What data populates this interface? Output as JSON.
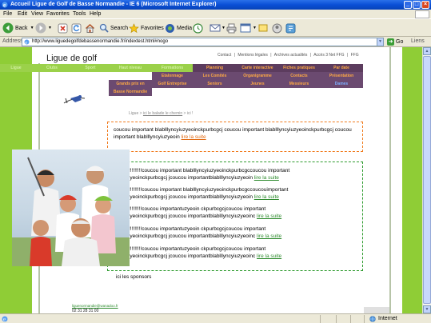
{
  "window": {
    "title": "Accueil Ligue de Golf de Basse Normandie - IE 6 (Microsoft Internet Explorer)",
    "controls": {
      "minimize": "_",
      "maximize": "□",
      "close": "×"
    }
  },
  "menubar": {
    "items": [
      "File",
      "Edit",
      "View",
      "Favorites",
      "Tools",
      "Help"
    ]
  },
  "toolbar": {
    "back_label": "Back",
    "search_label": "Search",
    "favorites_label": "Favorites",
    "media_label": "Media",
    "icons": [
      "back-icon",
      "forward-icon",
      "stop-icon",
      "refresh-icon",
      "home-icon",
      "search-icon",
      "favorites-icon",
      "media-icon",
      "history-icon",
      "mail-icon",
      "print-icon",
      "edit-icon",
      "discuss-icon",
      "messenger-icon",
      "research-icon"
    ]
  },
  "addressbar": {
    "label": "Address",
    "url": "http://www.liguedegolfdebassenormandie.fr/indextest.html#nogo",
    "go_label": "Go",
    "links_label": "Liens"
  },
  "page": {
    "site_title": "Ligue de golf",
    "toplinks": [
      "Contact",
      "|",
      "Mentions légales",
      "|",
      "Archives actualités",
      "|",
      "Accès 3 Net FFG",
      "|",
      "FFG"
    ],
    "nav_row1": [
      {
        "label": "Ligue",
        "style": "green"
      },
      {
        "label": "Clubs",
        "style": "green"
      },
      {
        "label": "Sport",
        "style": "green"
      },
      {
        "label": "Haut niveau",
        "style": "green"
      },
      {
        "label": "Formations",
        "style": "green"
      },
      {
        "label": "Planning",
        "style": "dark"
      },
      {
        "label": "Carte interactive",
        "style": "dark"
      },
      {
        "label": "Fiches pratiques",
        "style": "dark"
      },
      {
        "label": "Par date",
        "style": "dark"
      }
    ],
    "nav_row2": [
      {
        "label": "Etalonnage",
        "style": "dark"
      },
      {
        "label": "Les Comités",
        "style": "dark"
      },
      {
        "label": "Organigramme",
        "style": "dark"
      },
      {
        "label": "Contacts",
        "style": "dark"
      },
      {
        "label": "Présentation",
        "style": "dark"
      }
    ],
    "nav_row3": [
      {
        "label": "Grands prix en",
        "style": "dark"
      },
      {
        "label": "Golf Entreprise",
        "style": "dark"
      },
      {
        "label": "Seniors",
        "style": "dark"
      },
      {
        "label": "Jeunes",
        "style": "dark"
      },
      {
        "label": "Messieurs",
        "style": "dark"
      },
      {
        "label": "Dames",
        "style": "blue"
      }
    ],
    "nav_row4": [
      {
        "label": "Basse Normandie",
        "style": "dark"
      }
    ],
    "breadcrumb": {
      "prefix": "Ligue > ",
      "link": "ici le balade le chemin",
      "suffix": " > ici !"
    },
    "intro": {
      "text": "coucou important blablllyncyiuzyeoinckpurbcgcj coucou important blablllyncyiuzyeoinckpurbcgcj coucou important blablllyncyiuzyeoin",
      "link": "lire la suite"
    },
    "news": [
      {
        "line1": "lités !!!!!!!!!!!coucou important blablllyncyiuzyeoinckpurbcgccoucou important",
        "line2": "ncyiuzyeoinckpurbcgcj jcoucou importantblablllyncyiuzyeoin",
        "link": "lire la suite"
      },
      {
        "line1": "lités !!!!!!!!!!!coucou important blablllyncyiuzyeoinckpurbcgccoucouimportant",
        "line2": "ncyiuzyeoinckpurbcgcj jcoucou importantblablllyncyiuzyeoin",
        "link": "lire la suite"
      },
      {
        "line1": "lités !!!!!!!!!!!coucou importantuzyeoin ckpurbcgcjcoucou important",
        "line2": "ncyiuzyeoinckpurbcgcj jcoucou importantblablllyncyiuzyeoinc",
        "link": "lire la suite"
      },
      {
        "line1": "lités !!!!!!!!!!!coucou importantuzyeoin ckpurbcgcjcoucou important",
        "line2": "ncyiuzyeoinckpurbcgcj jcoucou importantblablllyncyiuzyeoinc",
        "link": "lire la suite"
      },
      {
        "line1": "lités !!!!!!!!!!!coucou importantuzyeoin ckpurbcgcjcoucou important",
        "line2": "ncyiuzyeoinckpurbcgcj jcoucou importantblablllyncyiuzyeoinc",
        "link": "lire la suite"
      }
    ],
    "sponsors": "ici les sponsors",
    "footer_email": "liguenormandie@wanadoo.fr",
    "footer_phone": "02 31 28 31 00"
  },
  "statusbar": {
    "zone": "Internet"
  },
  "colors": {
    "nav_dark": "#6b4a70",
    "nav_text": "#ffaa44",
    "green": "#8fcd36",
    "orange_border": "#f07a1c",
    "green_border": "#2c9a2c"
  }
}
